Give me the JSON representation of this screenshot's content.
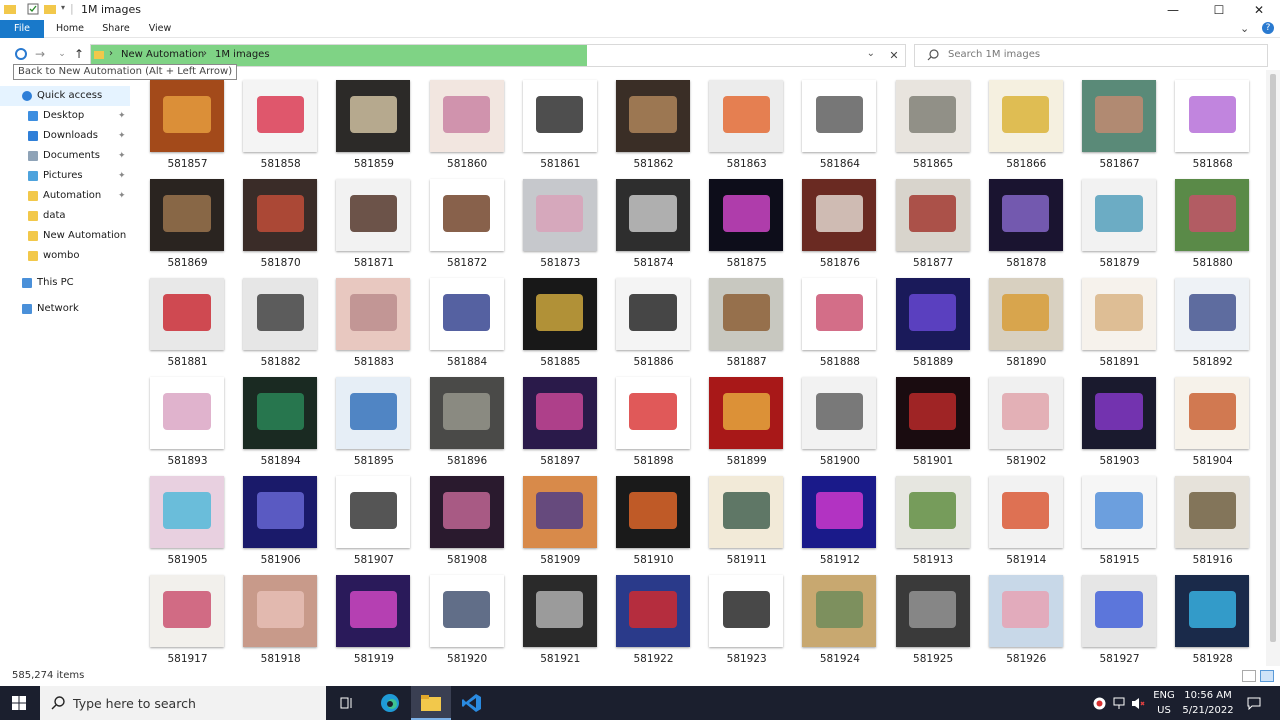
{
  "window": {
    "title": "1M images",
    "controls": {
      "minimize": "—",
      "maximize": "☐",
      "close": "✕"
    }
  },
  "ribbon": {
    "tabs": [
      "File",
      "Home",
      "Share",
      "View"
    ],
    "expand_glyph": "⌄",
    "help_glyph": "?"
  },
  "nav": {
    "back_tooltip": "Back to New Automation (Alt + Left Arrow)",
    "breadcrumb": [
      "New Automation",
      "1M images"
    ],
    "breadcrumb_sep": "›",
    "search_placeholder": "Search 1M images",
    "glyphs": {
      "back": "←",
      "forward": "→",
      "recent": "⌄",
      "up": "↑",
      "dropdown": "⌄",
      "clear": "✕"
    }
  },
  "sidebar": {
    "pin_glyph": "📌",
    "items": [
      {
        "label": "Quick access",
        "icon": "star-icon",
        "color": "#2f7fd8",
        "selected": true
      },
      {
        "label": "Desktop",
        "icon": "desktop-icon",
        "color": "#3d8ee0",
        "pinned": true
      },
      {
        "label": "Downloads",
        "icon": "download-icon",
        "color": "#2f7fd8",
        "pinned": true
      },
      {
        "label": "Documents",
        "icon": "documents-icon",
        "color": "#8fa3b7",
        "pinned": true
      },
      {
        "label": "Pictures",
        "icon": "pictures-icon",
        "color": "#4ea3dd",
        "pinned": true
      },
      {
        "label": "Automation",
        "icon": "folder-icon",
        "color": "#f2c84b",
        "pinned": true
      },
      {
        "label": "data",
        "icon": "folder-icon",
        "color": "#f2c84b"
      },
      {
        "label": "New Automation",
        "icon": "folder-icon",
        "color": "#f2c84b"
      },
      {
        "label": "wombo",
        "icon": "folder-icon",
        "color": "#f2c84b"
      },
      {
        "label": "This PC",
        "icon": "computer-icon",
        "color": "#4a90d9"
      },
      {
        "label": "Network",
        "icon": "network-icon",
        "color": "#4a90d9"
      }
    ]
  },
  "files": [
    {
      "name": "581857",
      "c1": "#a34a1a",
      "c2": "#e8a040"
    },
    {
      "name": "581858",
      "c1": "#f4f4f4",
      "c2": "#d9304a"
    },
    {
      "name": "581859",
      "c1": "#2c2a28",
      "c2": "#dac9a8"
    },
    {
      "name": "581860",
      "c1": "#f2e6e0",
      "c2": "#c77ea0"
    },
    {
      "name": "581861",
      "c1": "#ffffff",
      "c2": "#222222"
    },
    {
      "name": "581862",
      "c1": "#3a2e26",
      "c2": "#b58a5e"
    },
    {
      "name": "581863",
      "c1": "#ececec",
      "c2": "#e3642a"
    },
    {
      "name": "581864",
      "c1": "#ffffff",
      "c2": "#555555"
    },
    {
      "name": "581865",
      "c1": "#e8e4de",
      "c2": "#7b7b70"
    },
    {
      "name": "581866",
      "c1": "#f5f0e0",
      "c2": "#d9b030"
    },
    {
      "name": "581867",
      "c1": "#5a8a78",
      "c2": "#c78a70"
    },
    {
      "name": "581868",
      "c1": "#ffffff",
      "c2": "#b266d6"
    },
    {
      "name": "581869",
      "c1": "#2a2420",
      "c2": "#a07850"
    },
    {
      "name": "581870",
      "c1": "#3a2c28",
      "c2": "#c8503a"
    },
    {
      "name": "581871",
      "c1": "#f2f2f2",
      "c2": "#4a2a1e"
    },
    {
      "name": "581872",
      "c1": "#ffffff",
      "c2": "#6a3a1e"
    },
    {
      "name": "581873",
      "c1": "#c6c8cc",
      "c2": "#d9a0b8"
    },
    {
      "name": "581874",
      "c1": "#2e2e2e",
      "c2": "#d0d0d0"
    },
    {
      "name": "581875",
      "c1": "#0d0d1a",
      "c2": "#d84ad0"
    },
    {
      "name": "581876",
      "c1": "#6a2a22",
      "c2": "#e8e0d8"
    },
    {
      "name": "581877",
      "c1": "#d8d4cc",
      "c2": "#a03028"
    },
    {
      "name": "581878",
      "c1": "#1a1430",
      "c2": "#8a6ad0"
    },
    {
      "name": "581879",
      "c1": "#f2f2f2",
      "c2": "#4a9ab8"
    },
    {
      "name": "581880",
      "c1": "#5a8a48",
      "c2": "#c8506a"
    },
    {
      "name": "581881",
      "c1": "#e8e8e8",
      "c2": "#c8202a"
    },
    {
      "name": "581882",
      "c1": "#e6e6e6",
      "c2": "#3a3a3a"
    },
    {
      "name": "581883",
      "c1": "#e8c8c0",
      "c2": "#b88a8a"
    },
    {
      "name": "581884",
      "c1": "#ffffff",
      "c2": "#2a3a8a"
    },
    {
      "name": "581885",
      "c1": "#181818",
      "c2": "#d8b040"
    },
    {
      "name": "581886",
      "c1": "#f4f4f4",
      "c2": "#1a1a1a"
    },
    {
      "name": "581887",
      "c1": "#c8c8c0",
      "c2": "#8a5a2e"
    },
    {
      "name": "581888",
      "c1": "#ffffff",
      "c2": "#c84a6a"
    },
    {
      "name": "581889",
      "c1": "#1a1a5a",
      "c2": "#6a4ad8"
    },
    {
      "name": "581890",
      "c1": "#d8d0c0",
      "c2": "#d89a30"
    },
    {
      "name": "581891",
      "c1": "#f6f2ec",
      "c2": "#d8b080"
    },
    {
      "name": "581892",
      "c1": "#eef2f6",
      "c2": "#3a4a8a"
    },
    {
      "name": "581893",
      "c1": "#ffffff",
      "c2": "#d8a0c0"
    },
    {
      "name": "581894",
      "c1": "#1a2a22",
      "c2": "#2a8a5a"
    },
    {
      "name": "581895",
      "c1": "#e6eef6",
      "c2": "#2a6ab8"
    },
    {
      "name": "581896",
      "c1": "#4a4a48",
      "c2": "#9a9a90"
    },
    {
      "name": "581897",
      "c1": "#2a1a4a",
      "c2": "#d04a9a"
    },
    {
      "name": "581898",
      "c1": "#ffffff",
      "c2": "#d83030"
    },
    {
      "name": "581899",
      "c1": "#a81818",
      "c2": "#e8b040"
    },
    {
      "name": "581900",
      "c1": "#f2f2f2",
      "c2": "#5a5a5a"
    },
    {
      "name": "581901",
      "c1": "#1a0c10",
      "c2": "#c02a2a"
    },
    {
      "name": "581902",
      "c1": "#f0f0f0",
      "c2": "#e0a0a8"
    },
    {
      "name": "581903",
      "c1": "#1a1a2e",
      "c2": "#8a3ad0"
    },
    {
      "name": "581904",
      "c1": "#f6f2ea",
      "c2": "#c85a2a"
    },
    {
      "name": "581905",
      "c1": "#e8d0e0",
      "c2": "#4ab8d8"
    },
    {
      "name": "581906",
      "c1": "#1a1a6a",
      "c2": "#6a6ad8"
    },
    {
      "name": "581907",
      "c1": "#ffffff",
      "c2": "#2a2a2a"
    },
    {
      "name": "581908",
      "c1": "#2a1a2e",
      "c2": "#c86a9a"
    },
    {
      "name": "581909",
      "c1": "#d88a4a",
      "c2": "#4a3a8a"
    },
    {
      "name": "581910",
      "c1": "#1a1a1a",
      "c2": "#e86a2a"
    },
    {
      "name": "581911",
      "c1": "#f2ead8",
      "c2": "#3a5a4a"
    },
    {
      "name": "581912",
      "c1": "#1a1a8a",
      "c2": "#d83ad0"
    },
    {
      "name": "581913",
      "c1": "#e6e6e0",
      "c2": "#5a8a3a"
    },
    {
      "name": "581914",
      "c1": "#f2f2f2",
      "c2": "#d8502a"
    },
    {
      "name": "581915",
      "c1": "#f6f6f6",
      "c2": "#4a8ad8"
    },
    {
      "name": "581916",
      "c1": "#e6e2da",
      "c2": "#6a5a3a"
    },
    {
      "name": "581917",
      "c1": "#f2f0ec",
      "c2": "#c84a6a"
    },
    {
      "name": "581918",
      "c1": "#c89a8a",
      "c2": "#e8c0b8"
    },
    {
      "name": "581919",
      "c1": "#2a1a5a",
      "c2": "#d84ac8"
    },
    {
      "name": "581920",
      "c1": "#ffffff",
      "c2": "#3a4a6a"
    },
    {
      "name": "581921",
      "c1": "#2a2a2a",
      "c2": "#b8b8b8"
    },
    {
      "name": "581922",
      "c1": "#2a3a8a",
      "c2": "#d82a2a"
    },
    {
      "name": "581923",
      "c1": "#ffffff",
      "c2": "#1a1a1a"
    },
    {
      "name": "581924",
      "c1": "#c8a870",
      "c2": "#6a8a5a"
    },
    {
      "name": "581925",
      "c1": "#3a3a3a",
      "c2": "#9a9a9a"
    },
    {
      "name": "581926",
      "c1": "#c8d8e8",
      "c2": "#e8a0b0"
    },
    {
      "name": "581927",
      "c1": "#e6e6e6",
      "c2": "#3a5ad8"
    },
    {
      "name": "581928",
      "c1": "#1a2a4a",
      "c2": "#3ab8e8"
    }
  ],
  "status": {
    "item_count": "585,274 items"
  },
  "taskbar": {
    "search_placeholder": "Type here to search",
    "lang": "ENG",
    "region": "US",
    "time": "10:56 AM",
    "date": "5/21/2022"
  }
}
